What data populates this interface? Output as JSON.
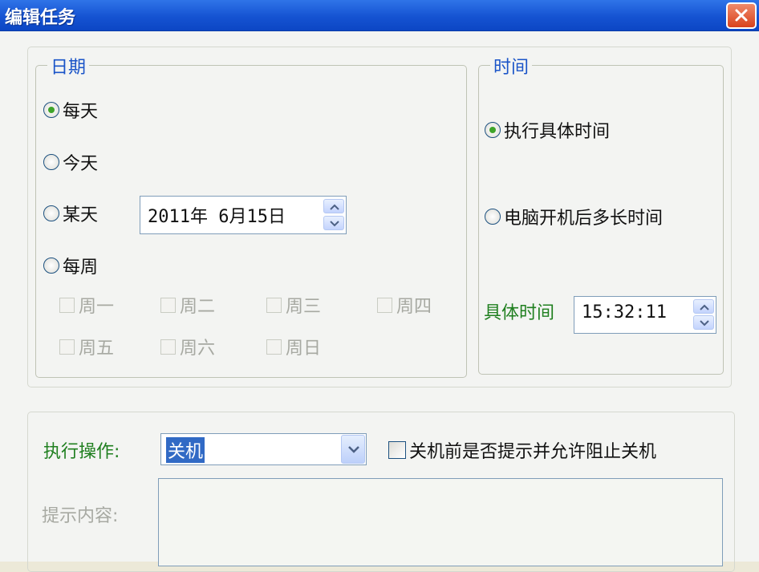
{
  "window": {
    "title": "编辑任务"
  },
  "date_group": {
    "label": "日期",
    "options": [
      {
        "label": "每天",
        "checked": true
      },
      {
        "label": "今天",
        "checked": false
      },
      {
        "label": "某天",
        "checked": false
      },
      {
        "label": "每周",
        "checked": false
      }
    ],
    "date_value": "2011年  6月15日",
    "weekdays": [
      "周一",
      "周二",
      "周三",
      "周四",
      "周五",
      "周六",
      "周日"
    ]
  },
  "time_group": {
    "label": "时间",
    "options": [
      {
        "label": "执行具体时间",
        "checked": true
      },
      {
        "label": "电脑开机后多长时间",
        "checked": false
      }
    ],
    "time_label": "具体时间",
    "time_value": "15:32:11"
  },
  "action": {
    "label": "执行操作:",
    "selected": "关机",
    "prompt_checkbox_label": "关机前是否提示并允许阻止关机",
    "prompt_checked": false,
    "content_label": "提示内容:",
    "content_value": ""
  }
}
